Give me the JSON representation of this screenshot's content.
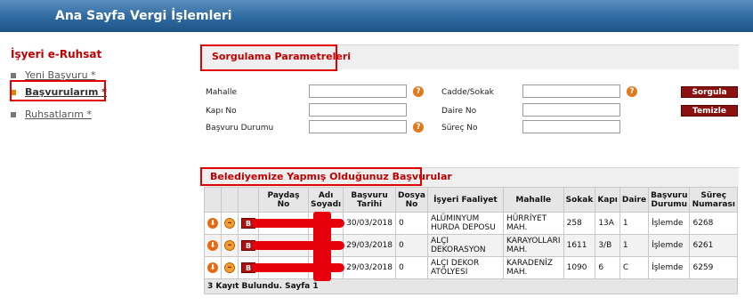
{
  "topnav": {
    "home": "Ana Sayfa",
    "tax": "Vergi İşlemleri"
  },
  "sidebar": {
    "title": "İşyeri e-Ruhsat",
    "items": [
      {
        "label": "Yeni Başvuru *"
      },
      {
        "label": "Başvurularım *"
      },
      {
        "label": "Ruhsatlarım *"
      }
    ]
  },
  "query": {
    "title": "Sorgulama Parametreleri",
    "labels": {
      "mahalle": "Mahalle",
      "kapi_no": "Kapı No",
      "basvuru_durumu": "Başvuru Durumu",
      "cadde": "Cadde/Sokak",
      "daire_no": "Daire No",
      "surec_no": "Süreç No"
    },
    "values": {
      "mahalle": "",
      "kapi_no": "",
      "basvuru_durumu": "",
      "cadde": "",
      "daire_no": "",
      "surec_no": ""
    },
    "search_button": "Sorgula",
    "clear_button": "Temizle",
    "help_glyph": "?"
  },
  "applications": {
    "title": "Belediyemize Yapmış Olduğunuz Başvurular",
    "columns": {
      "paydas": "Paydaş No",
      "adi": "Adı Soyadı",
      "tarih": "Başvuru Tarihi",
      "dosya": "Dosya No",
      "faaliyet": "İşyeri Faaliyet",
      "mahalle": "Mahalle",
      "sokak": "Sokak",
      "kapi": "Kapı",
      "daire": "Daire",
      "durum": "Başvuru Durumu",
      "surec": "Süreç Numarası"
    },
    "rows": [
      {
        "b": "B",
        "tarih": "30/03/2018",
        "dosya": "0",
        "faaliyet": "ALÜMINYUM HURDA DEPOSU",
        "mahalle": "HÜRRİYET MAH.",
        "sokak": "258",
        "kapi": "13A",
        "daire": "1",
        "durum": "İşlemde",
        "surec": "6268"
      },
      {
        "b": "B",
        "tarih": "29/03/2018",
        "dosya": "0",
        "faaliyet": "ALÇI DEKORASYON",
        "mahalle": "KARAYOLLARI MAH.",
        "sokak": "1611",
        "kapi": "3/B",
        "daire": "1",
        "durum": "İşlemde",
        "surec": "6261"
      },
      {
        "b": "B",
        "tarih": "29/03/2018",
        "dosya": "0",
        "faaliyet": "ALÇI DEKOR ATÖLYESI",
        "mahalle": "KARADENİZ MAH.",
        "sokak": "1090",
        "kapi": "6",
        "daire": "C",
        "durum": "İşlemde",
        "surec": "6259"
      }
    ],
    "footer": "3 Kayıt Bulundu. Sayfa 1"
  },
  "colors": {
    "accent_red": "#c00000",
    "topbar": "#2f6aa0",
    "highlight_box": "#e00000"
  },
  "icons": {
    "row_down": "down-arrow-circle-icon",
    "row_remove": "minus-circle-icon",
    "row_b": "b-badge-icon",
    "help": "question-circle-icon"
  }
}
